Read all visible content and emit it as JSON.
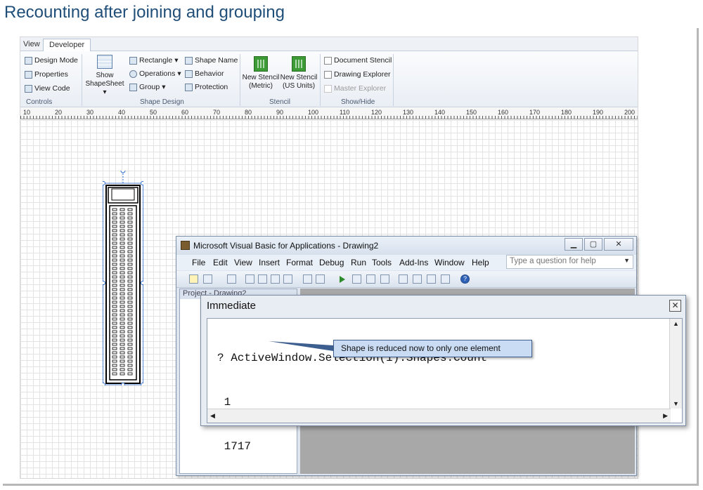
{
  "slide": {
    "title": "Recounting after joining and grouping"
  },
  "visio": {
    "tabs": [
      "View",
      "Developer"
    ],
    "controls": {
      "design_mode": "Design Mode",
      "properties": "Properties",
      "view_code": "View Code",
      "group": "Controls"
    },
    "shape_design": {
      "show_shapesheet": "Show",
      "show_shapesheet_2": "ShapeSheet",
      "rectangle": "Rectangle",
      "operations": "Operations",
      "group": "Group",
      "shape_name": "Shape Name",
      "behavior": "Behavior",
      "protection": "Protection",
      "label": "Shape Design"
    },
    "stencil": {
      "new_metric_1": "New Stencil",
      "new_metric_2": "(Metric)",
      "new_us_1": "New Stencil",
      "new_us_2": "(US Units)",
      "label": "Stencil"
    },
    "show_hide": {
      "document_stencil": "Document Stencil",
      "drawing_explorer": "Drawing Explorer",
      "master_explorer": "Master Explorer",
      "label": "Show/Hide"
    },
    "ruler_labels": [
      "10",
      "20",
      "30",
      "40",
      "50",
      "60",
      "70",
      "80",
      "90",
      "100",
      "110",
      "120",
      "130",
      "140",
      "150",
      "160",
      "170",
      "180",
      "190",
      "200"
    ]
  },
  "vba": {
    "title": "Microsoft Visual Basic for Applications - Drawing2",
    "menus": [
      "File",
      "Edit",
      "View",
      "Insert",
      "Format",
      "Debug",
      "Run",
      "Tools",
      "Add-Ins",
      "Window",
      "Help"
    ],
    "help_placeholder": "Type a question for help",
    "project_title": "Project - Drawing2"
  },
  "immediate": {
    "title": "Immediate",
    "lines": [
      "? ActiveWindow.Selection(1).Shapes.Count",
      " 1",
      " 1717"
    ]
  },
  "callout": {
    "text": "Shape is reduced now to only one element"
  },
  "colors": {
    "title": "#1f4e79",
    "callout_fill": "#c9dcf4",
    "callout_border": "#3d5f8f"
  }
}
